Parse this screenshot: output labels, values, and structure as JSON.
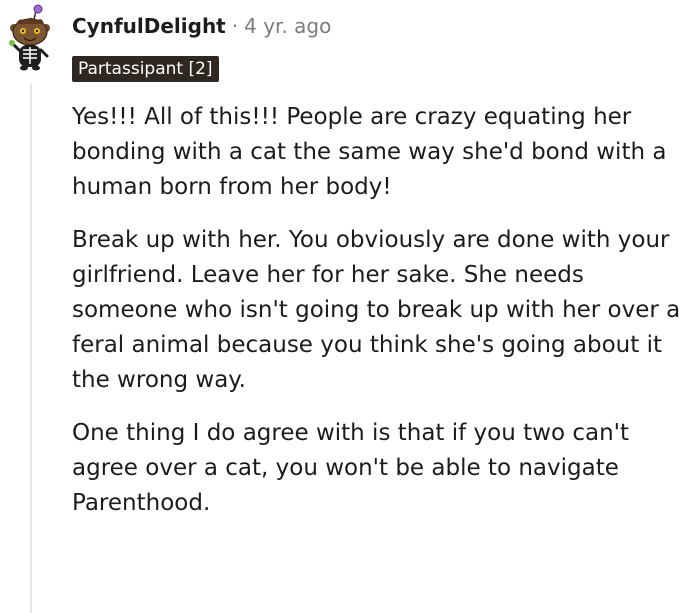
{
  "comment": {
    "username": "CynfulDelight",
    "separator": "·",
    "age": "4 yr. ago",
    "flair": "Partassipant [2]",
    "avatar_icon": "snoo-skeleton-avatar-icon",
    "paragraphs": [
      "Yes!!! All of this!!! People are crazy equating her bonding with a cat the same way she'd bond with a human born from her body!",
      "Break up with her. You obviously are done with your girlfriend. Leave her for her sake. She needs someone who isn't going to break up with her over a feral animal because you think she's going about it the wrong way.",
      "One thing I do agree with is that if you two can't agree over a cat, you won't be able to navigate Parenthood."
    ]
  },
  "colors": {
    "text": "#1c1c1c",
    "meta": "#7c7c7c",
    "flair_bg": "#2f2721",
    "flair_text": "#ffffff",
    "thread_line": "#e5e5e5"
  }
}
